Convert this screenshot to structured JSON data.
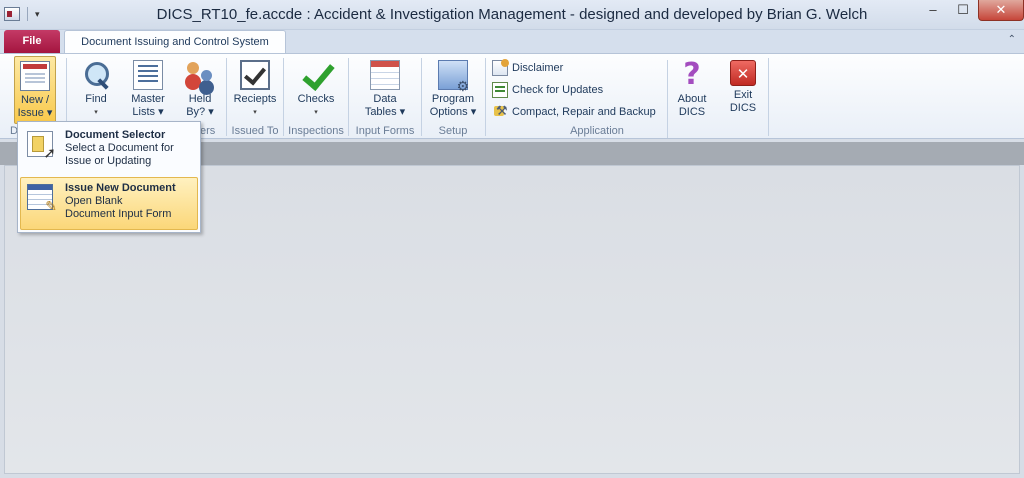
{
  "window": {
    "title": "DICS_RT10_fe.accde : Accident & Investigation Management - designed and developed by Brian G. Welch",
    "minimize_symbol": "–",
    "maximize_symbol": "☐",
    "close_symbol": "✕"
  },
  "qat": {
    "dropdown_symbol": "▾"
  },
  "tabs": {
    "file": "File",
    "active": "Document Issuing and Control System",
    "collapse_symbol": "⌃"
  },
  "ribbon": {
    "groups": {
      "document": {
        "label": "D",
        "hidden_by_menu": true
      },
      "find": {
        "button": "Find",
        "caret": "▾"
      },
      "master": {
        "line1": "Master",
        "line2": "Lists ▾",
        "label": "...hers"
      },
      "held": {
        "line1": "Held",
        "line2": "By? ▾"
      },
      "issued": {
        "button": "Reciepts",
        "caret": "▾",
        "label": "Issued To"
      },
      "inspections": {
        "button": "Checks",
        "caret": "▾",
        "label": "Inspections"
      },
      "input_forms": {
        "line1": "Data",
        "line2": "Tables ▾",
        "label": "Input Forms"
      },
      "setup": {
        "line1": "Program",
        "line2": "Options ▾",
        "label": "Setup"
      },
      "application": {
        "label": "Application",
        "items": [
          "Disclaimer",
          "Check for Updates",
          "Compact, Repair and Backup"
        ],
        "about_line1": "About",
        "about_line2": "DICS",
        "exit_line1": "Exit",
        "exit_line2": "DICS"
      }
    },
    "new_issue": {
      "line1": "New /",
      "line2": "Issue ▾"
    }
  },
  "menu": {
    "items": [
      {
        "title": "Document Selector",
        "desc1": "Select a Document for",
        "desc2": "Issue or Updating"
      },
      {
        "title": "Issue New Document",
        "desc1": "Open Blank",
        "desc2": "Document Input Form"
      }
    ]
  },
  "icons": {
    "about": "?",
    "exit": "✕"
  },
  "colors": {
    "file_tab": "#b52350",
    "highlight": "#fbd779",
    "ribbon_text": "#1e395b"
  }
}
